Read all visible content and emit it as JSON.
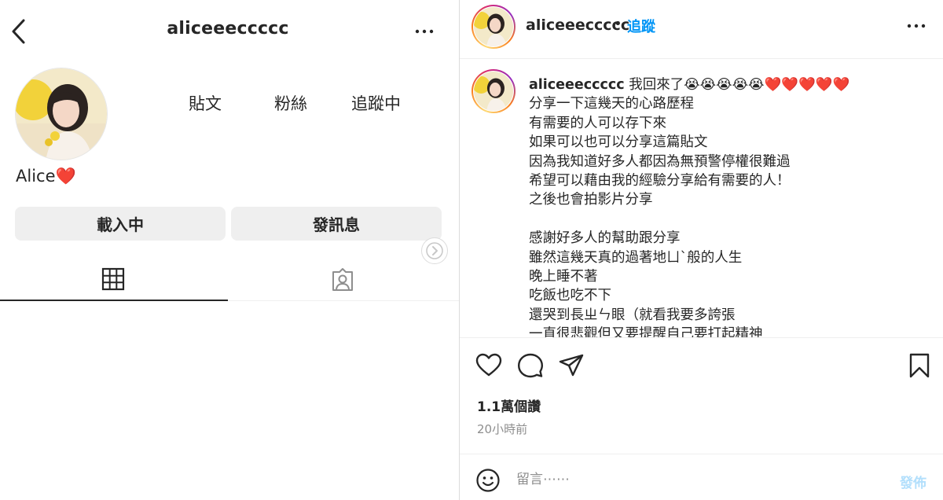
{
  "profile": {
    "username": "aliceeeccccc",
    "display_name": "Alice",
    "display_name_emoji": "❤️",
    "stats": {
      "posts_label": "貼文",
      "followers_label": "粉絲",
      "following_label": "追蹤中"
    },
    "buttons": {
      "loading_label": "載入中",
      "message_label": "發訊息"
    }
  },
  "post": {
    "username": "aliceeeccccc",
    "separator": "•",
    "follow_label": "追蹤",
    "caption": "我回來了😭😭😭😭😭❤️❤️❤️❤️❤️\n分享一下這幾天的心路歷程\n有需要的人可以存下來\n如果可以也可以分享這篇貼文\n因為我知道好多人都因為無預警停權很難過\n希望可以藉由我的經驗分享給有需要的人！\n之後也會拍影片分享\n\n感謝好多人的幫助跟分享\n雖然這幾天真的過著地ㄩˋ般的人生\n晚上睡不著\n吃飯也吃不下\n還哭到長ㄓㄣ眼（就看我要多誇張\n一直很悲觀但又要提醒自己要打起精神",
    "views": "1.1萬個讚",
    "time": "20小時前",
    "comment_placeholder": "留言⋯⋯",
    "post_label": "發佈"
  },
  "colors": {
    "accent": "#0095f6",
    "heart": "#e0162b",
    "post_disabled": "#b2dffc"
  }
}
